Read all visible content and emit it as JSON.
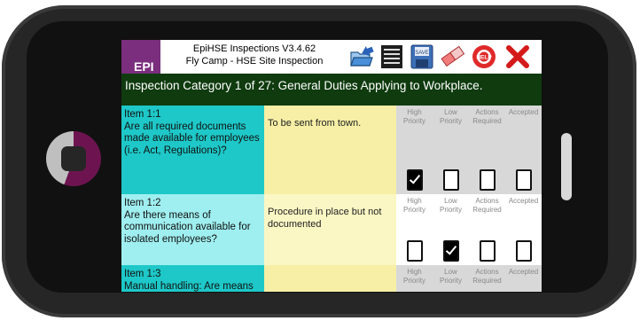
{
  "app": {
    "logo_text": "EPI",
    "title_line1": "EpiHSE Inspections V3.4.62",
    "title_line2": "Fly Camp - HSE Site Inspection"
  },
  "toolbar": {
    "icons": [
      "open-folder-icon",
      "list-icon",
      "save-icon",
      "eraser-icon",
      "help-icon",
      "close-icon"
    ],
    "save_label": "SAVE",
    "help_label": "HELP"
  },
  "category": {
    "text": "Inspection Category 1 of 27: General Duties Applying to Workplace."
  },
  "check_columns": [
    "High Priority",
    "Low Priority",
    "Actions Required",
    "Accepted"
  ],
  "items": [
    {
      "label": "Item 1:1",
      "question": "Are all required documents made available for employees (i.e. Act, Regulations)?",
      "comment": "To be sent from town.",
      "checks": [
        true,
        false,
        false,
        false
      ]
    },
    {
      "label": "Item 1:2",
      "question": "Are there means of communication available for isolated employees?",
      "comment": "Procedure in place but not documented",
      "checks": [
        false,
        true,
        false,
        false
      ]
    },
    {
      "label": "Item 1:3",
      "question": "Manual handling: Are means",
      "comment": "",
      "checks": [
        false,
        false,
        false,
        false
      ]
    }
  ],
  "colors": {
    "category_bar": "#0f3b0f",
    "item_cell": "#1ec8c8",
    "item_cell_alt": "#9feff0",
    "comment_cell": "#f6efa5",
    "logo": "#7a2e7d",
    "phone_accent": "#6d1450"
  }
}
